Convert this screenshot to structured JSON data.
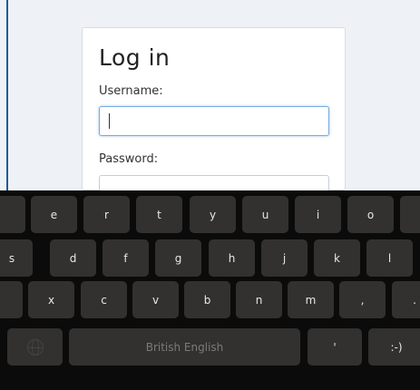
{
  "login": {
    "title": "Log in",
    "username_label": "Username:",
    "username_value": "",
    "password_label": "Password:",
    "password_value": ""
  },
  "keyboard": {
    "row1": [
      "e",
      "r",
      "t",
      "y",
      "u",
      "i",
      "o"
    ],
    "row2": [
      "s",
      "d",
      "f",
      "g",
      "h",
      "j",
      "k",
      "l"
    ],
    "row3": [
      "x",
      "c",
      "v",
      "b",
      "n",
      "m",
      ",",
      "."
    ],
    "space_label": "British English",
    "apostrophe": "'",
    "smiley": ":-)",
    "globe_icon": "globe-icon"
  }
}
